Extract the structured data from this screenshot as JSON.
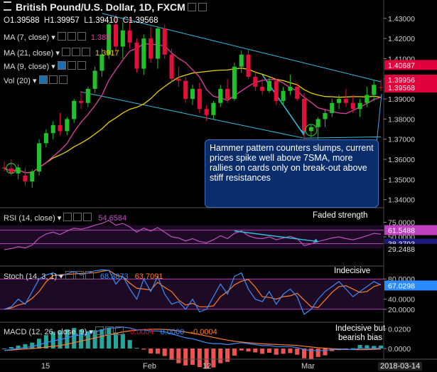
{
  "header": {
    "title": "British Pound/U.S. Dollar, 1D, FXCM",
    "ohlc": [
      {
        "key": "O",
        "val": "1.39588"
      },
      {
        "key": "H",
        "val": "1.39957"
      },
      {
        "key": "L",
        "val": "1.39410"
      },
      {
        "key": "C",
        "val": "1.39568"
      }
    ]
  },
  "legend": {
    "ma7": "MA (7, close)",
    "ma21": "MA (21, close)",
    "ma9": "MA (9, close)",
    "vol": "Vol (20)",
    "ma7_val": "1.385",
    "ma21_val": "1.3917",
    "rsi": "RSI (14, close)",
    "rsi_val": "54.6584",
    "stoch": "Stoch (14, 3, 1)",
    "stoch_k": "68.3873",
    "stoch_d": "63.7091",
    "macd": "MACD (12, 26, close, 9)",
    "macd_v1": "0.0004",
    "macd_v2": "0.0000",
    "macd_v3": "-0.0004"
  },
  "annotations": {
    "callout": "Hammer pattern counters slumps, current prices spike well above 7SMA, more rallies on cards only on break-out above stiff resistances",
    "rsi_note": "Faded strength",
    "stoch_note": "Indecisive",
    "macd_note": "Indecisive but bearish bias"
  },
  "price_axis": {
    "ticks": [
      "1.43000",
      "1.42000",
      "1.41000",
      "1.40000",
      "1.39000",
      "1.38000",
      "1.37000",
      "1.36000",
      "1.35000",
      "1.34000"
    ],
    "labels": [
      {
        "text": "1.40687",
        "bg": "#e0003c",
        "fg": "#ffffff"
      },
      {
        "text": "1.39956",
        "bg": "#e0003c",
        "fg": "#ffffff"
      },
      {
        "text": "1.39568",
        "bg": "#e0003c",
        "fg": "#ffffff"
      }
    ]
  },
  "rsi_axis": {
    "ticks": [
      "75.0000",
      "50.0000"
    ],
    "labels": [
      {
        "text": "61.5488",
        "bg": "#c040c0",
        "fg": "#ffffff"
      },
      {
        "text": "38.3793",
        "bg": "#1a1a7a",
        "fg": "#ffffff"
      },
      {
        "text": "29.2488",
        "bg": "#000000",
        "fg": "#dddddd"
      }
    ]
  },
  "stoch_axis": {
    "ticks": [
      "80.0000",
      "40.0000",
      "20.0000"
    ],
    "labels": [
      {
        "text": "67.0298",
        "bg": "#2a8bff",
        "fg": "#ffffff"
      }
    ]
  },
  "macd_axis": {
    "ticks": [
      "0.0200",
      "0.0000"
    ]
  },
  "time_axis": {
    "labels": [
      "15",
      "Feb",
      "12",
      "Mar",
      "2018-03-14"
    ]
  },
  "colors": {
    "up": "#22c02a",
    "down": "#e0103a",
    "ma7": "#e040a0",
    "ma21": "#e8d000",
    "channel": "#30c0e0",
    "rsi": "#c050c0",
    "stoch_k": "#3a8cff",
    "stoch_d": "#ff7f2a"
  },
  "chart_data": {
    "type": "candlestick",
    "title": "British Pound/U.S. Dollar, 1D, FXCM",
    "ylim": [
      1.336,
      1.437
    ],
    "candles": [
      {
        "o": 1.356,
        "h": 1.359,
        "l": 1.354,
        "c": 1.3555
      },
      {
        "o": 1.3555,
        "h": 1.36,
        "l": 1.352,
        "c": 1.353
      },
      {
        "o": 1.353,
        "h": 1.3575,
        "l": 1.35,
        "c": 1.356
      },
      {
        "o": 1.352,
        "h": 1.356,
        "l": 1.347,
        "c": 1.349
      },
      {
        "o": 1.349,
        "h": 1.355,
        "l": 1.346,
        "c": 1.354
      },
      {
        "o": 1.354,
        "h": 1.37,
        "l": 1.352,
        "c": 1.368
      },
      {
        "o": 1.368,
        "h": 1.375,
        "l": 1.366,
        "c": 1.373
      },
      {
        "o": 1.373,
        "h": 1.379,
        "l": 1.37,
        "c": 1.377
      },
      {
        "o": 1.377,
        "h": 1.383,
        "l": 1.372,
        "c": 1.374
      },
      {
        "o": 1.374,
        "h": 1.381,
        "l": 1.372,
        "c": 1.38
      },
      {
        "o": 1.38,
        "h": 1.39,
        "l": 1.378,
        "c": 1.389
      },
      {
        "o": 1.389,
        "h": 1.394,
        "l": 1.385,
        "c": 1.388
      },
      {
        "o": 1.388,
        "h": 1.396,
        "l": 1.386,
        "c": 1.395
      },
      {
        "o": 1.395,
        "h": 1.406,
        "l": 1.393,
        "c": 1.404
      },
      {
        "o": 1.404,
        "h": 1.415,
        "l": 1.401,
        "c": 1.412
      },
      {
        "o": 1.412,
        "h": 1.428,
        "l": 1.41,
        "c": 1.427
      },
      {
        "o": 1.427,
        "h": 1.432,
        "l": 1.413,
        "c": 1.416
      },
      {
        "o": 1.416,
        "h": 1.428,
        "l": 1.41,
        "c": 1.424
      },
      {
        "o": 1.424,
        "h": 1.43,
        "l": 1.415,
        "c": 1.418
      },
      {
        "o": 1.418,
        "h": 1.42,
        "l": 1.403,
        "c": 1.405
      },
      {
        "o": 1.405,
        "h": 1.422,
        "l": 1.402,
        "c": 1.42
      },
      {
        "o": 1.42,
        "h": 1.426,
        "l": 1.408,
        "c": 1.41
      },
      {
        "o": 1.41,
        "h": 1.426,
        "l": 1.405,
        "c": 1.425
      },
      {
        "o": 1.425,
        "h": 1.427,
        "l": 1.41,
        "c": 1.412
      },
      {
        "o": 1.412,
        "h": 1.415,
        "l": 1.398,
        "c": 1.4
      },
      {
        "o": 1.4,
        "h": 1.406,
        "l": 1.396,
        "c": 1.399
      },
      {
        "o": 1.399,
        "h": 1.401,
        "l": 1.388,
        "c": 1.39
      },
      {
        "o": 1.39,
        "h": 1.397,
        "l": 1.387,
        "c": 1.395
      },
      {
        "o": 1.395,
        "h": 1.398,
        "l": 1.383,
        "c": 1.385
      },
      {
        "o": 1.385,
        "h": 1.387,
        "l": 1.379,
        "c": 1.382
      },
      {
        "o": 1.382,
        "h": 1.389,
        "l": 1.38,
        "c": 1.388
      },
      {
        "o": 1.388,
        "h": 1.397,
        "l": 1.386,
        "c": 1.395
      },
      {
        "o": 1.395,
        "h": 1.4,
        "l": 1.388,
        "c": 1.39
      },
      {
        "o": 1.39,
        "h": 1.408,
        "l": 1.389,
        "c": 1.406
      },
      {
        "o": 1.406,
        "h": 1.414,
        "l": 1.403,
        "c": 1.412
      },
      {
        "o": 1.412,
        "h": 1.415,
        "l": 1.4,
        "c": 1.401
      },
      {
        "o": 1.401,
        "h": 1.404,
        "l": 1.394,
        "c": 1.396
      },
      {
        "o": 1.396,
        "h": 1.4,
        "l": 1.392,
        "c": 1.394
      },
      {
        "o": 1.394,
        "h": 1.401,
        "l": 1.393,
        "c": 1.399
      },
      {
        "o": 1.399,
        "h": 1.4,
        "l": 1.387,
        "c": 1.389
      },
      {
        "o": 1.389,
        "h": 1.396,
        "l": 1.387,
        "c": 1.394
      },
      {
        "o": 1.394,
        "h": 1.402,
        "l": 1.392,
        "c": 1.396
      },
      {
        "o": 1.396,
        "h": 1.398,
        "l": 1.389,
        "c": 1.39
      },
      {
        "o": 1.39,
        "h": 1.393,
        "l": 1.37,
        "c": 1.374
      },
      {
        "o": 1.374,
        "h": 1.377,
        "l": 1.371,
        "c": 1.376
      },
      {
        "o": 1.376,
        "h": 1.381,
        "l": 1.37,
        "c": 1.38
      },
      {
        "o": 1.38,
        "h": 1.385,
        "l": 1.376,
        "c": 1.383
      },
      {
        "o": 1.383,
        "h": 1.39,
        "l": 1.381,
        "c": 1.388
      },
      {
        "o": 1.388,
        "h": 1.392,
        "l": 1.385,
        "c": 1.39
      },
      {
        "o": 1.39,
        "h": 1.395,
        "l": 1.386,
        "c": 1.388
      },
      {
        "o": 1.388,
        "h": 1.392,
        "l": 1.383,
        "c": 1.385
      },
      {
        "o": 1.385,
        "h": 1.39,
        "l": 1.381,
        "c": 1.388
      },
      {
        "o": 1.388,
        "h": 1.396,
        "l": 1.386,
        "c": 1.392
      },
      {
        "o": 1.392,
        "h": 1.399,
        "l": 1.389,
        "c": 1.397
      },
      {
        "o": 1.3959,
        "h": 1.3996,
        "l": 1.3941,
        "c": 1.3957
      }
    ],
    "ma7_last": 1.385,
    "ma21_last": 1.3917,
    "rsi_last": 54.6584,
    "stoch_k_last": 68.3873,
    "stoch_d_last": 63.7091,
    "macd_last": {
      "macd": 0.0004,
      "signal": 0.0,
      "hist": -0.0004
    }
  }
}
